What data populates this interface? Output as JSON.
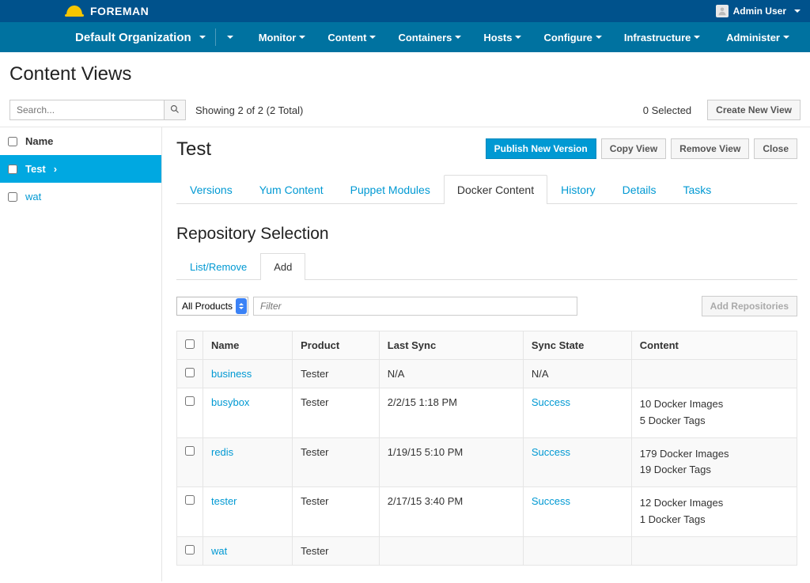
{
  "brand": "FOREMAN",
  "user_name": "Admin User",
  "org_label": "Default Organization",
  "nav": {
    "monitor": "Monitor",
    "content": "Content",
    "containers": "Containers",
    "hosts": "Hosts",
    "configure": "Configure",
    "infrastructure": "Infrastructure",
    "administer": "Administer"
  },
  "page_title": "Content Views",
  "search_placeholder": "Search...",
  "showing_text": "Showing 2 of 2 (2 Total)",
  "selected_text": "0 Selected",
  "create_view_label": "Create New View",
  "sidebar": {
    "header": "Name",
    "items": [
      {
        "label": "Test",
        "active": true
      },
      {
        "label": "wat",
        "active": false
      }
    ]
  },
  "cv": {
    "title": "Test",
    "actions": {
      "publish": "Publish New Version",
      "copy": "Copy View",
      "remove": "Remove View",
      "close": "Close"
    },
    "tabs": {
      "versions": "Versions",
      "yum": "Yum Content",
      "puppet": "Puppet Modules",
      "docker": "Docker Content",
      "history": "History",
      "details": "Details",
      "tasks": "Tasks"
    },
    "repo_section_title": "Repository Selection",
    "subtabs": {
      "listremove": "List/Remove",
      "add": "Add"
    },
    "product_filter": "All Products",
    "filter_placeholder": "Filter",
    "add_repos_label": "Add Repositories",
    "table": {
      "headers": {
        "name": "Name",
        "product": "Product",
        "last_sync": "Last Sync",
        "sync_state": "Sync State",
        "content": "Content"
      },
      "rows": [
        {
          "name": "business",
          "product": "Tester",
          "last_sync": "N/A",
          "sync_state": "N/A",
          "sync_link": false,
          "content_images": "",
          "content_tags": ""
        },
        {
          "name": "busybox",
          "product": "Tester",
          "last_sync": "2/2/15 1:18 PM",
          "sync_state": "Success",
          "sync_link": true,
          "content_images": "10 Docker Images",
          "content_tags": "5 Docker Tags"
        },
        {
          "name": "redis",
          "product": "Tester",
          "last_sync": "1/19/15 5:10 PM",
          "sync_state": "Success",
          "sync_link": true,
          "content_images": "179 Docker Images",
          "content_tags": "19 Docker Tags"
        },
        {
          "name": "tester",
          "product": "Tester",
          "last_sync": "2/17/15 3:40 PM",
          "sync_state": "Success",
          "sync_link": true,
          "content_images": "12 Docker Images",
          "content_tags": "1 Docker Tags"
        },
        {
          "name": "wat",
          "product": "Tester",
          "last_sync": "",
          "sync_state": "",
          "sync_link": false,
          "content_images": "",
          "content_tags": ""
        }
      ]
    }
  }
}
